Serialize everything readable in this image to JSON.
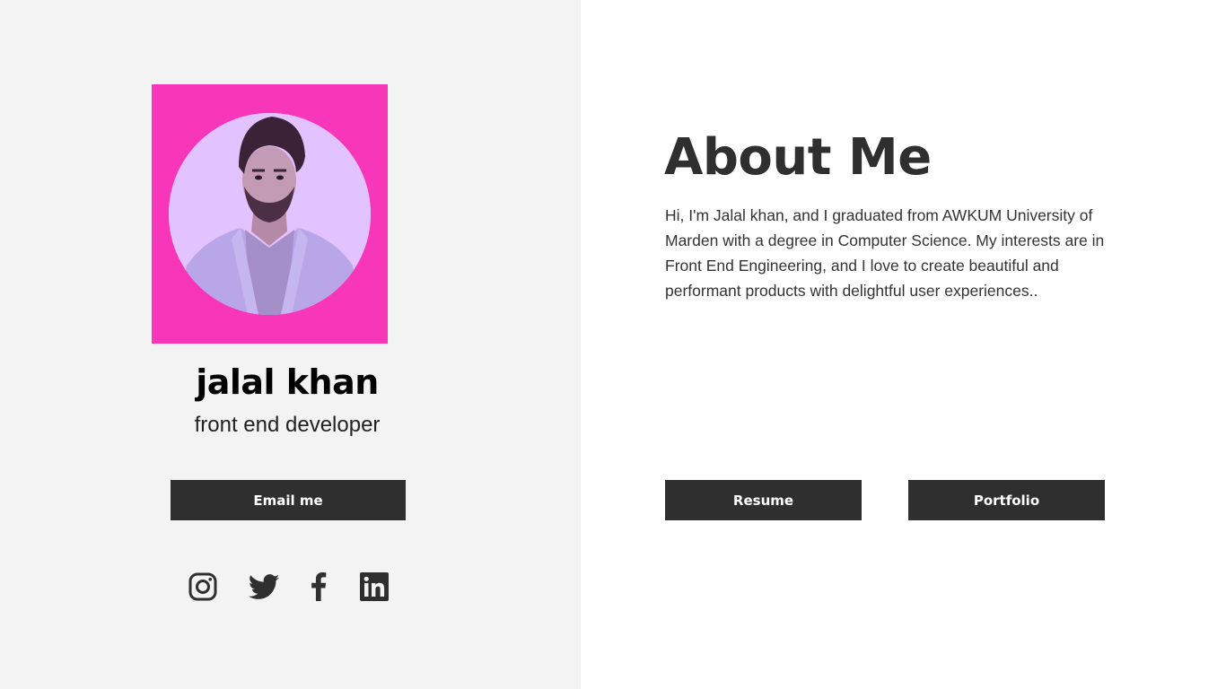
{
  "profile": {
    "name": "jalal khan",
    "role": "front end developer",
    "email_button": "Email me"
  },
  "social": [
    "instagram-icon",
    "twitter-icon",
    "facebook-icon",
    "linkedin-icon"
  ],
  "about": {
    "title": "About Me",
    "text": "Hi, I'm Jalal khan, and I graduated from AWKUM University of Marden with a degree in Computer Science. My interests are in Front End Engineering, and I love to create beautiful and performant products with delightful user experiences..",
    "resume_button": "Resume",
    "portfolio_button": "Portfolio"
  },
  "colors": {
    "left_bg": "#f3f3f3",
    "photo_frame": "#f736ba",
    "photo_circle": "#e3c3ff",
    "button_bg": "#2f2f2f",
    "button_text": "#ffffff"
  }
}
